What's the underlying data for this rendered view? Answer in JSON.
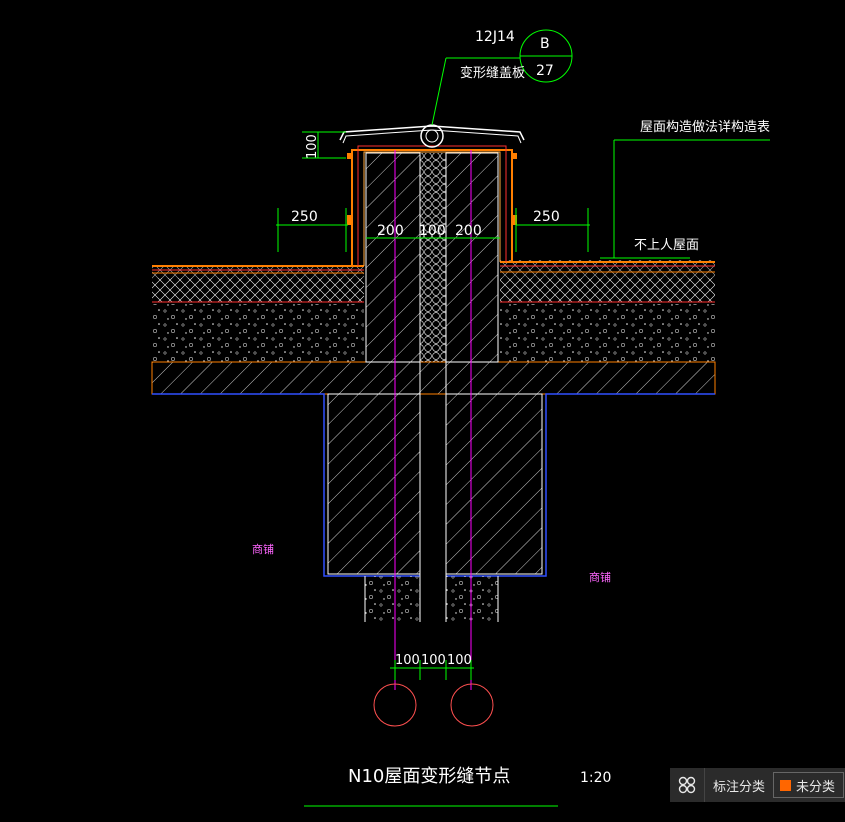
{
  "drawing": {
    "title": "N10屋面变形缝节点",
    "scale": "1:20",
    "ref_code": "12J14",
    "callout_top": "B",
    "callout_bottom": "27",
    "cover_label": "变形缝盖板",
    "spec_label": "屋面构造做法详构造表",
    "roof_label": "不上人屋面",
    "room_left": "商铺",
    "room_right": "商铺",
    "dim_100": "100",
    "dim_250_left": "250",
    "dim_250_right": "250",
    "dim_200_left": "200",
    "dim_100_mid": "100",
    "dim_200_right": "200",
    "dim_bottom": [
      "100",
      "100",
      "100"
    ]
  },
  "colors": {
    "background": "#000000",
    "concrete": "#ffffff",
    "leader": "#00ff00",
    "dimension": "#00ff00",
    "membrane": "#ff7f00",
    "layer_line": "#ff3030",
    "axis": "#ff00ff",
    "outline": "#3050ff"
  },
  "toolbar": {
    "icon": "grid-icon",
    "label": "标注分类",
    "category": "未分类",
    "category_color": "#ff6600"
  }
}
